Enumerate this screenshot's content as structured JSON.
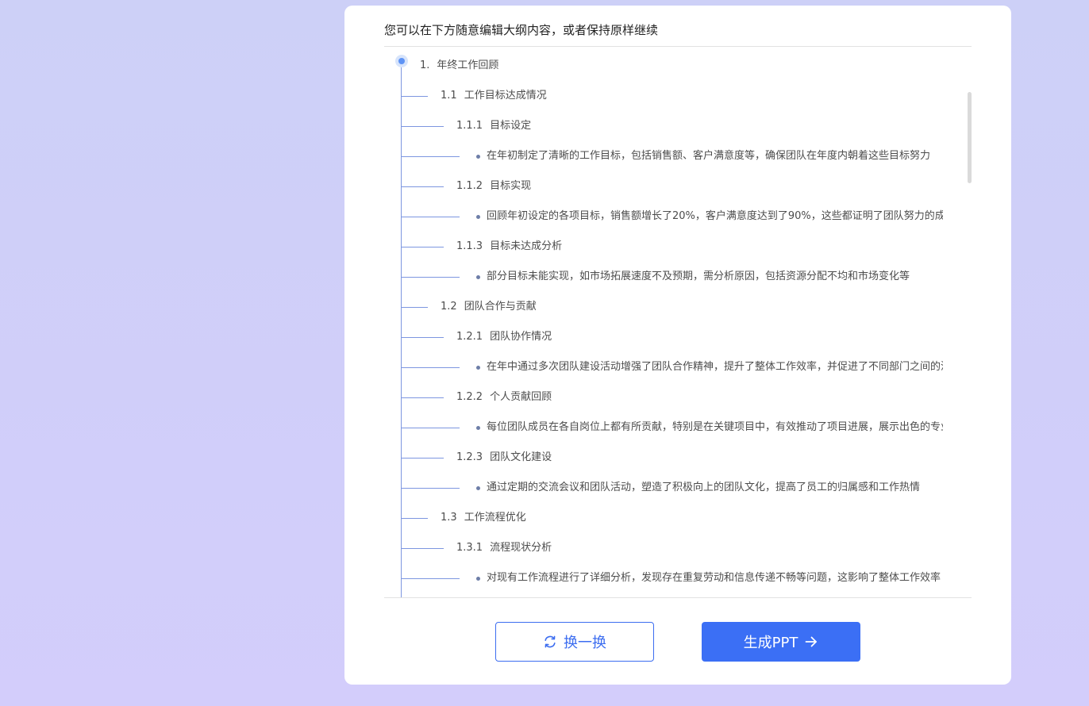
{
  "header": {
    "instruction": "您可以在下方随意编辑大纲内容，或者保持原样继续"
  },
  "outline": {
    "root": {
      "num": "1.",
      "title": "年终工作回顾"
    },
    "sections": [
      {
        "num": "1.1",
        "title": "工作目标达成情况",
        "subsections": [
          {
            "num": "1.1.1",
            "title": "目标设定",
            "bullet": "在年初制定了清晰的工作目标，包括销售额、客户满意度等，确保团队在年度内朝着这些目标努力"
          },
          {
            "num": "1.1.2",
            "title": "目标实现",
            "bullet": "回顾年初设定的各项目标，销售额增长了20%，客户满意度达到了90%，这些都证明了团队努力的成效"
          },
          {
            "num": "1.1.3",
            "title": "目标未达成分析",
            "bullet": "部分目标未能实现，如市场拓展速度不及预期，需分析原因，包括资源分配不均和市场变化等"
          }
        ]
      },
      {
        "num": "1.2",
        "title": "团队合作与贡献",
        "subsections": [
          {
            "num": "1.2.1",
            "title": "团队协作情况",
            "bullet": "在年中通过多次团队建设活动增强了团队合作精神，提升了整体工作效率，并促进了不同部门之间的沟通"
          },
          {
            "num": "1.2.2",
            "title": "个人贡献回顾",
            "bullet": "每位团队成员在各自岗位上都有所贡献，特别是在关键项目中，有效推动了项目进展，展示出色的专业能力"
          },
          {
            "num": "1.2.3",
            "title": "团队文化建设",
            "bullet": "通过定期的交流会议和团队活动，塑造了积极向上的团队文化，提高了员工的归属感和工作热情"
          }
        ]
      },
      {
        "num": "1.3",
        "title": "工作流程优化",
        "subsections": [
          {
            "num": "1.3.1",
            "title": "流程现状分析",
            "bullet": "对现有工作流程进行了详细分析，发现存在重复劳动和信息传递不畅等问题，这影响了整体工作效率"
          }
        ]
      }
    ]
  },
  "actions": {
    "refresh_label": "换一换",
    "refresh_icon": "refresh-icon",
    "generate_label": "生成PPT",
    "generate_icon": "arrow-right-icon"
  },
  "colors": {
    "accent": "#3b6ff5",
    "tree_line": "#7d96e0",
    "background": "#d0cef9"
  }
}
